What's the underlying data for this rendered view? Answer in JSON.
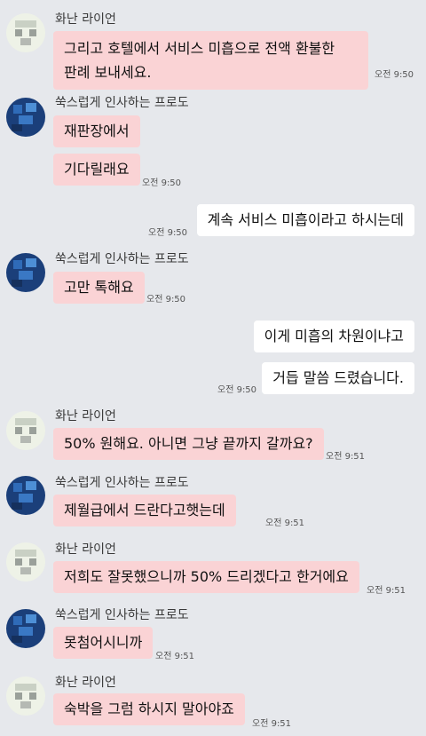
{
  "senders": {
    "a": "화난 라이언",
    "b": "쑥스럽게 인사하는 프로도"
  },
  "messages": [
    {
      "text_line1": "그리고 호텔에서 서비스 미흡으로 전액 환불한",
      "text_line2": "판례 보내세요.",
      "time": "오전 9:50"
    },
    {
      "text": "재판장에서"
    },
    {
      "text": "기다릴래요",
      "time": "오전 9:50"
    },
    {
      "text": "계속 서비스 미흡이라고 하시는데",
      "time": "오전 9:50"
    },
    {
      "text": "고만 톡해요",
      "time": "오전 9:50"
    },
    {
      "text": "이게 미흡의 차원이냐고"
    },
    {
      "text": "거듭 말씀 드렸습니다.",
      "time": "오전 9:50"
    },
    {
      "text": "50% 원해요. 아니면 그냥 끝까지 갈까요?",
      "time": "오전 9:51"
    },
    {
      "text": "제월급에서 드란다고햇는데",
      "time": "오전 9:51"
    },
    {
      "text": "저희도 잘못했으니까 50% 드리겠다고 한거에요",
      "time": "오전 9:51"
    },
    {
      "text": "못첨어시니까",
      "time": "오전 9:51"
    },
    {
      "text": "숙박을 그럼 하시지 말아야죠",
      "time": "오전 9:51"
    }
  ]
}
